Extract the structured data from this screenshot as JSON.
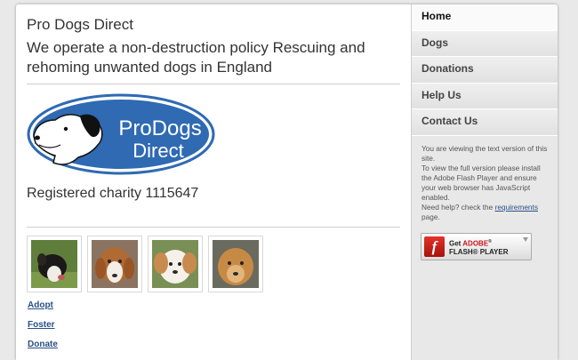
{
  "site": {
    "title": "Pro Dogs Direct",
    "tagline": "We operate a non-destruction policy Rescuing and rehoming unwanted dogs in England"
  },
  "logo": {
    "line1": "ProDogs",
    "line2": "Direct",
    "brand_color": "#2f6ab3"
  },
  "charity": "Registered charity 1115647",
  "links": [
    "Adopt",
    "Foster",
    "Donate"
  ],
  "nav": {
    "items": [
      "Home",
      "Dogs",
      "Donations",
      "Help Us",
      "Contact Us"
    ],
    "active_index": 0
  },
  "sidebar_text": {
    "line1": "You are viewing the text version of this site.",
    "line2": "To view the full version please install the Adobe Flash Player and ensure your web browser has JavaScript enabled.",
    "line3_prefix": "Need help? check the",
    "line3_link": "requirements",
    "line3_suffix": "page."
  },
  "flash_button": {
    "icon_glyph": "f",
    "get": "Get",
    "brand": "ADOBE",
    "reg": "®",
    "player": "FLASH® PLAYER"
  }
}
